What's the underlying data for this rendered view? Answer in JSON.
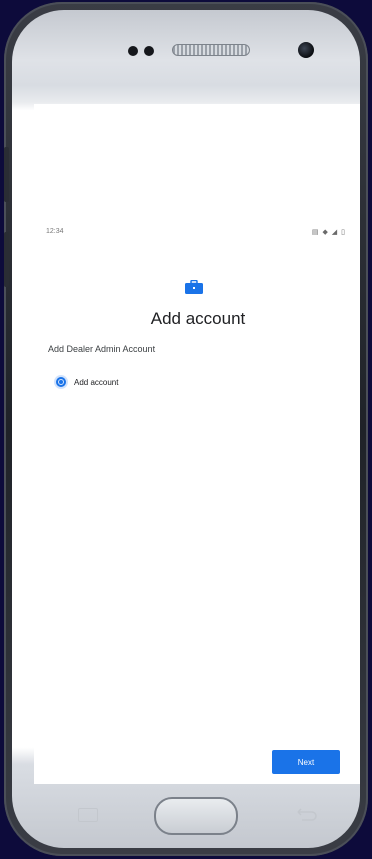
{
  "status_bar": {
    "time": "12:34",
    "icons": "▤ ◆ ◢ ▯"
  },
  "icon": "briefcase-icon",
  "title": "Add account",
  "subtitle": "Add Dealer Admin Account",
  "option": {
    "label": "Add account",
    "selected": true
  },
  "next_label": "Next",
  "colors": {
    "accent": "#1a73e8",
    "background": "#0d0b3b"
  }
}
